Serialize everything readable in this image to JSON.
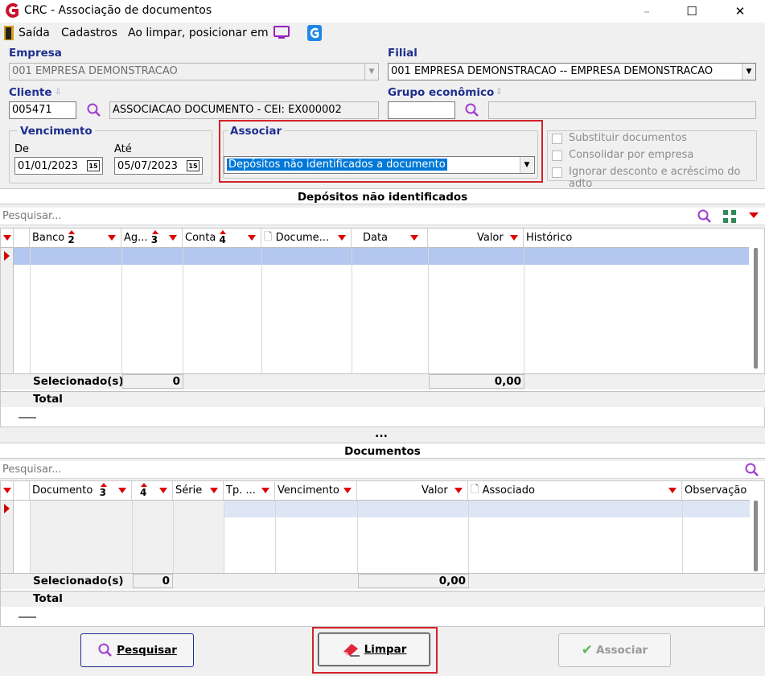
{
  "window": {
    "title": "CRC - Associação de documentos",
    "minimize": "–",
    "maximize": "☐",
    "close": "✕"
  },
  "menu": {
    "exit": "Saída",
    "register": "Cadastros",
    "position_label": "Ao limpar, posicionar em"
  },
  "empresa": {
    "label": "Empresa",
    "value": "001 EMPRESA DEMONSTRACAO"
  },
  "filial": {
    "label": "Filial",
    "value": "001 EMPRESA DEMONSTRACAO -- EMPRESA DEMONSTRACAO"
  },
  "cliente": {
    "label": "Cliente",
    "code": "005471",
    "name": "ASSOCIACAO DOCUMENTO - CEI: EX000002"
  },
  "grupo": {
    "label": "Grupo econômico",
    "code": "",
    "name": ""
  },
  "vencimento": {
    "label": "Vencimento",
    "from_label": "De",
    "from": "01/01/2023",
    "to_label": "Até",
    "to": "05/07/2023",
    "cal_icon_text": "15"
  },
  "associar": {
    "label": "Associar",
    "value": "Depósitos não identificados a documento"
  },
  "options": {
    "opt1": "Substituir documentos",
    "opt2": "Consolidar por empresa",
    "opt3": "Ignorar desconto e acréscimo do adto"
  },
  "deposits": {
    "title": "Depósitos não identificados",
    "search_placeholder": "Pesquisar...",
    "columns": {
      "banco": "Banco",
      "banco_sort": "2",
      "ag": "Ag...",
      "ag_sort": "3",
      "conta": "Conta",
      "conta_sort": "4",
      "documento": "Docume...",
      "data": "Data",
      "valor": "Valor",
      "historico": "Histórico"
    },
    "selected_label": "Selecionado(s)",
    "selected_count": "0",
    "selected_value": "0,00",
    "total_label": "Total"
  },
  "splitter": "...",
  "documents": {
    "title": "Documentos",
    "search_placeholder": "Pesquisar...",
    "columns": {
      "documento": "Documento",
      "documento_sort": "3",
      "col2_sort": "4",
      "serie": "Série",
      "tipo": "Tp. ...",
      "vencimento": "Vencimento",
      "valor": "Valor",
      "associado": "Associado",
      "observacao": "Observação"
    },
    "selected_label": "Selecionado(s)",
    "selected_count": "0",
    "selected_value": "0,00",
    "total_label": "Total"
  },
  "buttons": {
    "search": "Pesquisar",
    "clear": "Limpar",
    "associate": "Associar"
  },
  "colors": {
    "accent_blue": "#1f2f8f",
    "highlight_red": "#d3232a",
    "selection": "#0078d7"
  }
}
